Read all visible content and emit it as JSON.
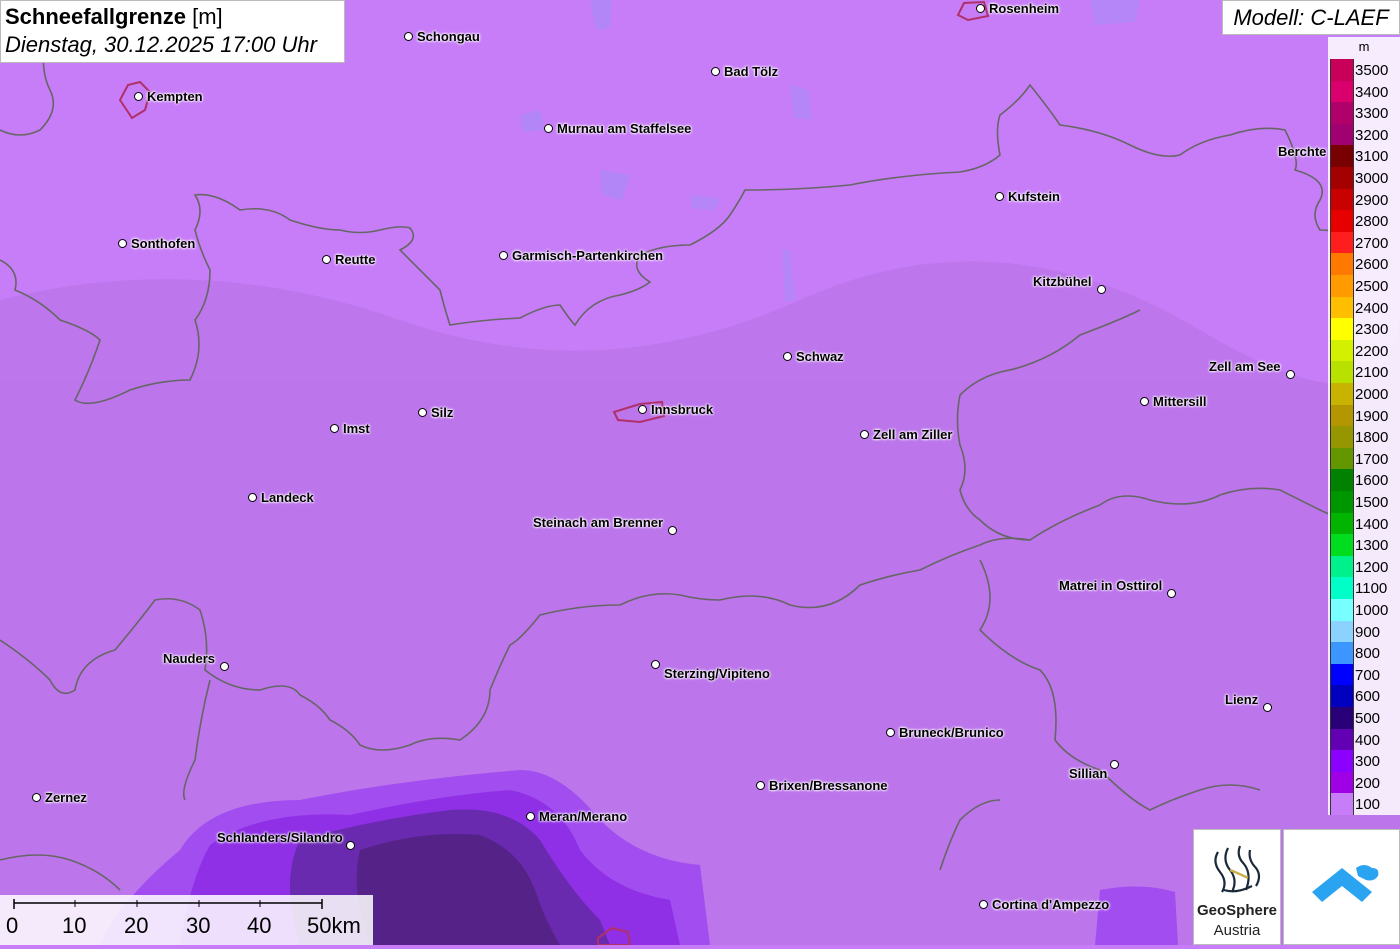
{
  "header": {
    "title": "Schneefallgrenze",
    "unit": "[m]",
    "datetime": "Dienstag, 30.12.2025 17:00 Uhr",
    "model": "Modell: C-LAEF"
  },
  "legend": {
    "unit": "m",
    "entries": [
      {
        "value": "3500",
        "color": "#c8005a"
      },
      {
        "value": "3400",
        "color": "#d9006e"
      },
      {
        "value": "3300",
        "color": "#b0006a"
      },
      {
        "value": "3200",
        "color": "#a00070"
      },
      {
        "value": "3100",
        "color": "#780000"
      },
      {
        "value": "3000",
        "color": "#a50000"
      },
      {
        "value": "2900",
        "color": "#c80000"
      },
      {
        "value": "2800",
        "color": "#e60000"
      },
      {
        "value": "2700",
        "color": "#ff1e1e"
      },
      {
        "value": "2600",
        "color": "#ff7800"
      },
      {
        "value": "2500",
        "color": "#ff9b00"
      },
      {
        "value": "2400",
        "color": "#ffbe00"
      },
      {
        "value": "2300",
        "color": "#ffff00"
      },
      {
        "value": "2200",
        "color": "#d2f000"
      },
      {
        "value": "2100",
        "color": "#b9e100"
      },
      {
        "value": "2000",
        "color": "#c8b400"
      },
      {
        "value": "1900",
        "color": "#b49600"
      },
      {
        "value": "1800",
        "color": "#969600"
      },
      {
        "value": "1700",
        "color": "#649600"
      },
      {
        "value": "1600",
        "color": "#008200"
      },
      {
        "value": "1500",
        "color": "#009600"
      },
      {
        "value": "1400",
        "color": "#00b400"
      },
      {
        "value": "1300",
        "color": "#00dc1e"
      },
      {
        "value": "1200",
        "color": "#00f08c"
      },
      {
        "value": "1100",
        "color": "#00ffc8"
      },
      {
        "value": "1000",
        "color": "#78ffff"
      },
      {
        "value": "900",
        "color": "#8cd2ff"
      },
      {
        "value": "800",
        "color": "#3c96ff"
      },
      {
        "value": "700",
        "color": "#0000ff"
      },
      {
        "value": "600",
        "color": "#0000be"
      },
      {
        "value": "500",
        "color": "#280078"
      },
      {
        "value": "400",
        "color": "#6400b4"
      },
      {
        "value": "300",
        "color": "#8c00ff"
      },
      {
        "value": "200",
        "color": "#a000e6"
      },
      {
        "value": "100",
        "color": "#c77df7"
      }
    ]
  },
  "cities": [
    {
      "name": "Schongau"
    },
    {
      "name": "Rosenheim"
    },
    {
      "name": "Kempten"
    },
    {
      "name": "Bad Tölz"
    },
    {
      "name": "Murnau am Staffelsee"
    },
    {
      "name": "Berchte"
    },
    {
      "name": "Kufstein"
    },
    {
      "name": "Sonthofen"
    },
    {
      "name": "Reutte"
    },
    {
      "name": "Garmisch-Partenkirchen"
    },
    {
      "name": "Kitzbühel"
    },
    {
      "name": "Schwaz"
    },
    {
      "name": "Zell am See"
    },
    {
      "name": "Mittersill"
    },
    {
      "name": "Innsbruck"
    },
    {
      "name": "Silz"
    },
    {
      "name": "Imst"
    },
    {
      "name": "Zell am Ziller"
    },
    {
      "name": "Landeck"
    },
    {
      "name": "Steinach am Brenner"
    },
    {
      "name": "Matrei in Osttirol"
    },
    {
      "name": "Nauders"
    },
    {
      "name": "Sterzing/Vipiteno"
    },
    {
      "name": "Lienz"
    },
    {
      "name": "Bruneck/Brunico"
    },
    {
      "name": "Sillian"
    },
    {
      "name": "Zernez"
    },
    {
      "name": "Brixen/Bressanone"
    },
    {
      "name": "Meran/Merano"
    },
    {
      "name": "Schlanders/Silandro"
    },
    {
      "name": "Cortina d'Ampezzo"
    }
  ],
  "scale_bar": {
    "labels": [
      "0",
      "10",
      "20",
      "30",
      "40",
      "50km"
    ]
  },
  "logo": {
    "name": "GeoSphere",
    "sub": "Austria"
  },
  "colors": {
    "base_fill": "#c77df7",
    "border_line": "#666666",
    "city_outline": "#b0306a"
  }
}
